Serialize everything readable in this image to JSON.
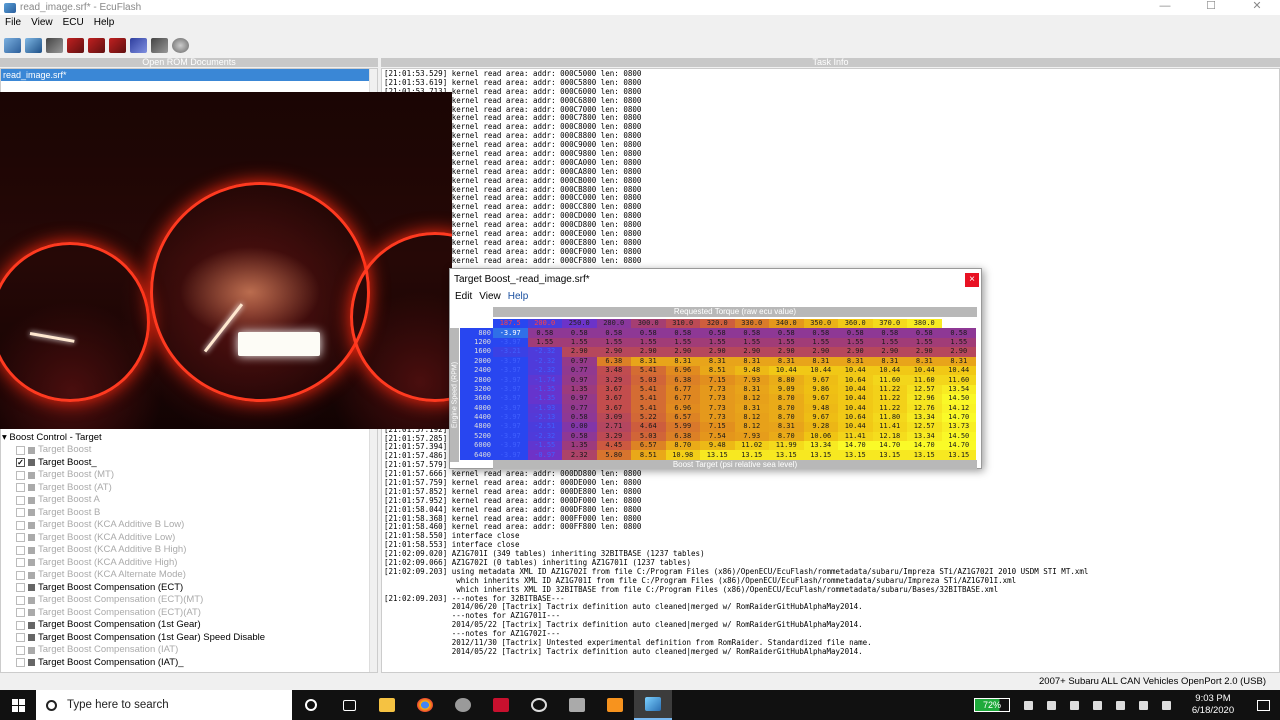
{
  "window": {
    "title": "read_image.srf* - EcuFlash",
    "min": "—",
    "max": "☐",
    "close": "✕"
  },
  "menu": [
    "File",
    "View",
    "ECU",
    "Help"
  ],
  "toolbar_icons": [
    "open-icon",
    "save-icon",
    "car-icon",
    "read-ecu-icon",
    "write-ecu-icon",
    "test-write-icon",
    "compare-icon",
    "chip-icon",
    "settings-icon"
  ],
  "left_pane": {
    "header": "Open ROM Documents",
    "document": "read_image.srf*",
    "tree": {
      "root": "Boost Control - Target",
      "items": [
        {
          "label": "Target Boost",
          "checked": false,
          "enabled": false
        },
        {
          "label": "Target Boost_",
          "checked": true,
          "enabled": true
        },
        {
          "label": "Target Boost (MT)",
          "checked": false,
          "enabled": false
        },
        {
          "label": "Target Boost (AT)",
          "checked": false,
          "enabled": false
        },
        {
          "label": "Target Boost A",
          "checked": false,
          "enabled": false
        },
        {
          "label": "Target Boost B",
          "checked": false,
          "enabled": false
        },
        {
          "label": "Target Boost (KCA Additive B Low)",
          "checked": false,
          "enabled": false
        },
        {
          "label": "Target Boost (KCA Additive Low)",
          "checked": false,
          "enabled": false
        },
        {
          "label": "Target Boost (KCA Additive B High)",
          "checked": false,
          "enabled": false
        },
        {
          "label": "Target Boost (KCA Additive High)",
          "checked": false,
          "enabled": false
        },
        {
          "label": "Target Boost (KCA Alternate Mode)",
          "checked": false,
          "enabled": false
        },
        {
          "label": "Target Boost Compensation (ECT)",
          "checked": false,
          "enabled": true
        },
        {
          "label": "Target Boost Compensation (ECT)(MT)",
          "checked": false,
          "enabled": false
        },
        {
          "label": "Target Boost Compensation (ECT)(AT)",
          "checked": false,
          "enabled": false
        },
        {
          "label": "Target Boost Compensation (1st Gear)",
          "checked": false,
          "enabled": true
        },
        {
          "label": "Target Boost Compensation (1st Gear) Speed Disable",
          "checked": false,
          "enabled": true
        },
        {
          "label": "Target Boost Compensation (IAT)",
          "checked": false,
          "enabled": false
        },
        {
          "label": "Target Boost Compensation (IAT)_",
          "checked": false,
          "enabled": true
        }
      ]
    }
  },
  "right_pane": {
    "header": "Task Info",
    "log": [
      "[21:01:53.529] kernel read area: addr: 000C5000 len: 0800",
      "[21:01:53.619] kernel read area: addr: 000C5800 len: 0800",
      "[21:01:53.713] kernel read area: addr: 000C6000 len: 0800",
      "[21:01:53.808] kernel read area: addr: 000C6800 len: 0800",
      "[21:01:53.902] kernel read area: addr: 000C7000 len: 0800",
      "[21:01:53.996] kernel read area: addr: 000C7800 len: 0800",
      "[21:01:54.090] kernel read area: addr: 000C8000 len: 0800",
      "[21:01:54.185] kernel read area: addr: 000C8800 len: 0800",
      "[21:01:54.279] kernel read area: addr: 000C9000 len: 0800",
      "[21:01:54.373] kernel read area: addr: 000C9800 len: 0800",
      "[21:01:54.467] kernel read area: addr: 000CA000 len: 0800",
      "[21:01:54.562] kernel read area: addr: 000CA800 len: 0800",
      "[21:01:54.656] kernel read area: addr: 000CB000 len: 0800",
      "[21:01:54.750] kernel read area: addr: 000CB800 len: 0800",
      "[21:01:54.845] kernel read area: addr: 000CC000 len: 0800",
      "[21:01:54.939] kernel read area: addr: 000CC800 len: 0800",
      "[21:01:55.033] kernel read area: addr: 000CD000 len: 0800",
      "[21:01:55.127] kernel read area: addr: 000CD800 len: 0800",
      "[21:01:55.222] kernel read area: addr: 000CE000 len: 0800",
      "[21:01:55.316] kernel read area: addr: 000CE800 len: 0800",
      "[21:01:55.410] kernel read area: addr: 000CF000 len: 0800",
      "[21:01:55.504] kernel read area: addr: 000CF800 len: 0800",
      "",
      "",
      "",
      "",
      "",
      "",
      "",
      "",
      "",
      "",
      "",
      "",
      "",
      "",
      "",
      "",
      "",
      "",
      "[21:01:57.192] kernel read area: addr: 000DA800 len: 0800",
      "[21:01:57.285] kernel read area: addr: 000DB000 len: 0800",
      "[21:01:57.394] kernel read area: addr: 000DB800 len: 0800",
      "[21:01:57.486] kernel read area: addr: 000DC000 len: 0800",
      "[21:01:57.579] kernel read area: addr: 000DC800 len: 0800",
      "[21:01:57.666] kernel read area: addr: 000DD800 len: 0800",
      "[21:01:57.759] kernel read area: addr: 000DE000 len: 0800",
      "[21:01:57.852] kernel read area: addr: 000DE800 len: 0800",
      "[21:01:57.952] kernel read area: addr: 000DF000 len: 0800",
      "[21:01:58.044] kernel read area: addr: 000DF800 len: 0800",
      "[21:01:58.368] kernel read area: addr: 000FF000 len: 0800",
      "[21:01:58.460] kernel read area: addr: 000FF800 len: 0800",
      "[21:01:58.550] interface close",
      "[21:01:58.553] interface close",
      "[21:02:09.020] AZ1G701I (349 tables) inheriting 32BITBASE (1237 tables)",
      "[21:02:09.066] AZ1G702I (0 tables) inheriting AZ1G701I (1237 tables)",
      "[21:02:09.203] using metadata XML ID AZ1G702I from file C:/Program Files (x86)/OpenECU/EcuFlash/rommetadata/subaru/Impreza STi/AZ1G702I 2010 USDM STI MT.xml",
      "                which inherits XML ID AZ1G701I from file C:/Program Files (x86)/OpenECU/EcuFlash/rommetadata/subaru/Impreza STi/AZ1G701I.xml",
      "                which inherits XML ID 32BITBASE from file C:/Program Files (x86)/OpenECU/EcuFlash/rommetadata/subaru/Bases/32BITBASE.xml",
      "[21:02:09.203] ---notes for 32BITBASE---",
      "               2014/06/20 [Tactrix] Tactrix definition auto cleaned|merged w/ RomRaiderGitHubAlphaMay2014.",
      "               ---notes for AZ1G701I---",
      "               2014/05/22 [Tactrix] Tactrix definition auto cleaned|merged w/ RomRaiderGitHubAlphaMay2014.",
      "               ---notes for AZ1G702I---",
      "               2012/11/30 [Tactrix] Untested experimental definition from RomRaider. Standardized file name.",
      "               2014/05/22 [Tactrix] Tactrix definition auto cleaned|merged w/ RomRaiderGitHubAlphaMay2014."
    ]
  },
  "dialog": {
    "title": "Target Boost_-read_image.srf*",
    "close": "×",
    "menu": [
      "Edit",
      "View",
      "Help"
    ],
    "x_axis_label": "Requested Torque (raw ecu value)",
    "y_axis_label": "Engine Speed (RPM)",
    "bottom_label": "Boost Target (psi relative sea level)",
    "columns": [
      "",
      "187.5",
      "200.0",
      "250.0",
      "280.0",
      "300.0",
      "310.0",
      "320.0",
      "330.0",
      "340.0",
      "350.0",
      "360.0",
      "370.0",
      "380.0"
    ],
    "rows": [
      {
        "rpm": "800",
        "vals": [
          "-3.97",
          "0.58",
          "0.58",
          "0.58",
          "0.58",
          "0.58",
          "0.58",
          "0.58",
          "0.58",
          "0.58",
          "0.58",
          "0.58",
          "0.58",
          "0.58"
        ]
      },
      {
        "rpm": "1200",
        "vals": [
          "-3.97",
          "1.55",
          "1.55",
          "1.55",
          "1.55",
          "1.55",
          "1.55",
          "1.55",
          "1.55",
          "1.55",
          "1.55",
          "1.55",
          "1.55",
          "1.55"
        ]
      },
      {
        "rpm": "1600",
        "vals": [
          "-3.21",
          "-2.32",
          "2.90",
          "2.90",
          "2.90",
          "2.90",
          "2.90",
          "2.90",
          "2.90",
          "2.90",
          "2.90",
          "2.90",
          "2.90",
          "2.90"
        ]
      },
      {
        "rpm": "2000",
        "vals": [
          "-3.97",
          "-2.32",
          "0.97",
          "6.38",
          "8.31",
          "8.31",
          "8.31",
          "8.31",
          "8.31",
          "8.31",
          "8.31",
          "8.31",
          "8.31",
          "8.31"
        ]
      },
      {
        "rpm": "2400",
        "vals": [
          "-3.97",
          "-2.32",
          "0.77",
          "3.48",
          "5.41",
          "6.96",
          "8.51",
          "9.48",
          "10.44",
          "10.44",
          "10.44",
          "10.44",
          "10.44",
          "10.44"
        ]
      },
      {
        "rpm": "2800",
        "vals": [
          "-3.97",
          "-1.74",
          "0.97",
          "3.29",
          "5.03",
          "6.38",
          "7.15",
          "7.93",
          "8.80",
          "9.67",
          "10.64",
          "11.60",
          "11.60",
          "11.60"
        ]
      },
      {
        "rpm": "3200",
        "vals": [
          "-3.97",
          "-1.35",
          "1.35",
          "3.67",
          "5.41",
          "6.77",
          "7.73",
          "8.31",
          "9.09",
          "9.86",
          "10.44",
          "11.22",
          "12.57",
          "13.54"
        ]
      },
      {
        "rpm": "3600",
        "vals": [
          "-3.97",
          "-1.35",
          "0.97",
          "3.67",
          "5.41",
          "6.77",
          "7.73",
          "8.12",
          "8.70",
          "9.67",
          "10.44",
          "11.22",
          "12.96",
          "14.50"
        ]
      },
      {
        "rpm": "4000",
        "vals": [
          "-3.97",
          "-1.93",
          "0.77",
          "3.67",
          "5.41",
          "6.96",
          "7.73",
          "8.31",
          "8.70",
          "9.48",
          "10.44",
          "11.22",
          "12.76",
          "14.12"
        ]
      },
      {
        "rpm": "4400",
        "vals": [
          "-3.97",
          "-2.13",
          "0.58",
          "3.09",
          "5.22",
          "6.57",
          "7.73",
          "8.12",
          "8.70",
          "9.67",
          "10.64",
          "11.80",
          "13.34",
          "14.70"
        ]
      },
      {
        "rpm": "4800",
        "vals": [
          "-3.97",
          "-2.51",
          "0.00",
          "2.71",
          "4.64",
          "5.99",
          "7.15",
          "8.12",
          "8.31",
          "9.28",
          "10.44",
          "11.41",
          "12.57",
          "13.73"
        ]
      },
      {
        "rpm": "5200",
        "vals": [
          "-3.97",
          "-2.32",
          "0.58",
          "3.29",
          "5.03",
          "6.38",
          "7.54",
          "7.93",
          "8.70",
          "10.06",
          "11.41",
          "12.18",
          "13.34",
          "14.50"
        ]
      },
      {
        "rpm": "6000",
        "vals": [
          "-3.97",
          "-1.55",
          "1.35",
          "4.45",
          "6.57",
          "8.70",
          "9.48",
          "11.02",
          "11.99",
          "13.34",
          "14.70",
          "14.70",
          "14.70",
          "14.70"
        ]
      },
      {
        "rpm": "6400",
        "vals": [
          "-3.97",
          "-0.97",
          "2.32",
          "5.80",
          "8.51",
          "10.98",
          "13.15",
          "13.15",
          "13.15",
          "13.15",
          "13.15",
          "13.15",
          "13.15",
          "13.15"
        ]
      }
    ]
  },
  "statusbar": {
    "text": "2007+ Subaru ALL CAN Vehicles  OpenPort 2.0 (USB)"
  },
  "taskbar": {
    "search_placeholder": "Type here to search",
    "battery": "72%",
    "time": "9:03 PM",
    "date": "6/18/2020"
  }
}
